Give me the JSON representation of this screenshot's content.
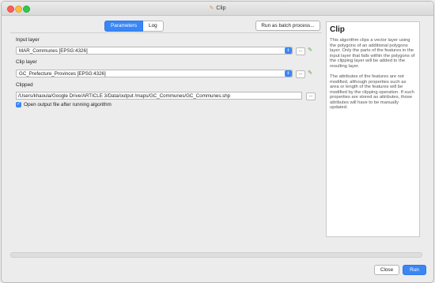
{
  "window": {
    "title": "Clip"
  },
  "tabs": {
    "parameters": "Parameters",
    "log": "Log"
  },
  "batch_button": "Run as batch process...",
  "input_layer": {
    "label": "Input layer",
    "value": "MAR_Communes [EPSG:4326]"
  },
  "clip_layer": {
    "label": "Clip layer",
    "value": "GC_Prefecture_Provinces [EPSG:4326]"
  },
  "clipped": {
    "label": "Clipped",
    "value": "/Users/khaoula/Google Drive/ARTICLE 3/Data/output /maps/GC_Communes/GC_Communes.shp"
  },
  "ellipsis": "...",
  "open_output": {
    "label": "Open output file after running algorithm",
    "checked": true
  },
  "help": {
    "title": "Clip",
    "p1": "This algorithm clips a vector layer using the polygons of an additional polygons layer. Only the parts of the features in the input layer that falls within the polygons of the clipping layer will be added to the resulting layer.",
    "p2": "The attributes of the features are not modified, although properties such as area or length of the features will be modified by the clipping operation. If such properties are stored as attributes, those attributes will have to be manually updated."
  },
  "buttons": {
    "close": "Close",
    "run": "Run"
  },
  "progress": {
    "value": 0
  }
}
